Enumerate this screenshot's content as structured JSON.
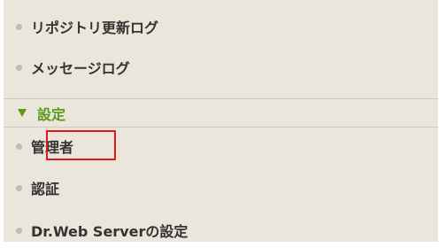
{
  "menu": {
    "logs_items": [
      {
        "label": "リポジトリ更新ログ"
      },
      {
        "label": "メッセージログ"
      }
    ],
    "settings_section": {
      "toggle": "▼",
      "label": "設定",
      "items": [
        {
          "label": "管理者",
          "highlighted": true
        },
        {
          "label": "認証"
        },
        {
          "label": "Dr.Web Serverの設定"
        }
      ]
    }
  },
  "colors": {
    "panel_bg": "#eae6dc",
    "section_header": "#5b9a1a",
    "highlight_border": "#e01a1a",
    "text": "#333333",
    "bullet": "#bcbcbc"
  }
}
